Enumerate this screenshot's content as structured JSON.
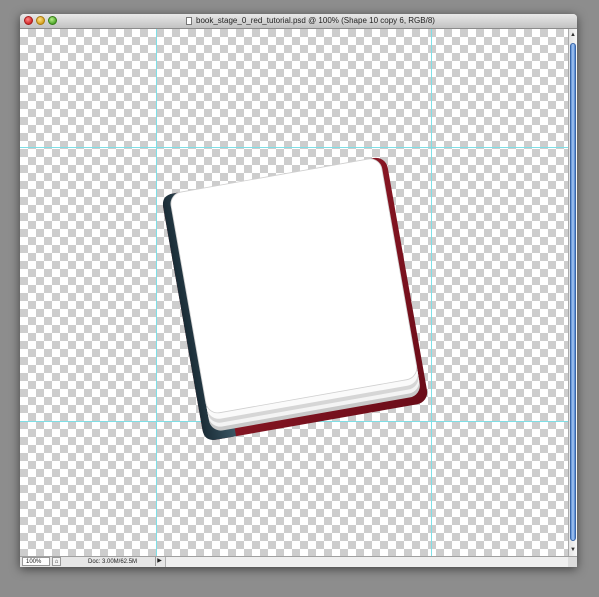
{
  "window": {
    "title": "book_stage_0_red_tutorial.psd @ 100% (Shape 10 copy 6, RGB/8)"
  },
  "statusbar": {
    "zoom": "100%",
    "doc_info": "Doc: 3.00M/62.5M",
    "menu_arrow": "▶"
  },
  "scrollbar": {
    "up_arrow": "▲",
    "down_arrow": "▼"
  },
  "icons": {
    "close": "close-icon",
    "minimize": "minimize-icon",
    "zoom": "zoom-icon",
    "document": "document-icon",
    "book": "book-illustration"
  },
  "colors": {
    "guide": "#7fdfe6",
    "book_cover_red": "#8a1424",
    "book_spine_dark": "#233c48",
    "scroll_thumb": "#5a8ed6"
  }
}
